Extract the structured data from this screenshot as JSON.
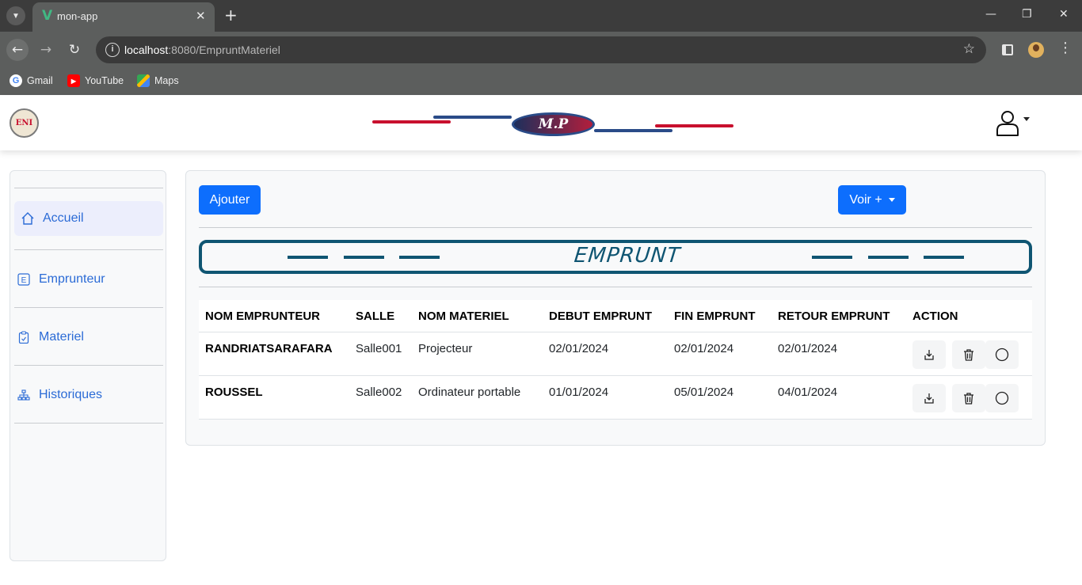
{
  "browser": {
    "tab_title": "mon-app",
    "tab_close": "✕",
    "new_tab": "+",
    "url_host": "localhost",
    "url_path": ":8080/EmpruntMateriel",
    "bookmarks": [
      {
        "label": "Gmail",
        "icon": "google-icon"
      },
      {
        "label": "YouTube",
        "icon": "youtube-icon"
      },
      {
        "label": "Maps",
        "icon": "maps-icon"
      }
    ]
  },
  "header": {
    "logo_text": "ENI",
    "brand": "M.P",
    "colors": {
      "red": "#c8102e",
      "blue": "#2a4b88"
    }
  },
  "sidebar": {
    "items": [
      {
        "label": "Accueil",
        "icon": "home-icon",
        "active": true
      },
      {
        "label": "Emprunteur",
        "icon": "letter-e-icon",
        "active": false
      },
      {
        "label": "Materiel",
        "icon": "clipboard-icon",
        "active": false
      },
      {
        "label": "Historiques",
        "icon": "sitemap-icon",
        "active": false
      }
    ]
  },
  "main": {
    "add_label": "Ajouter",
    "voir_label": "Voir +",
    "banner_title": "EMPRUNT",
    "table": {
      "headers": [
        "NOM EMPRUNTEUR",
        "SALLE",
        "NOM MATERIEL",
        "DEBUT EMPRUNT",
        "FIN EMPRUNT",
        "RETOUR EMPRUNT",
        "ACTION"
      ],
      "rows": [
        [
          "RANDRIATSARAFARA",
          "Salle001",
          "Projecteur",
          "02/01/2024",
          "02/01/2024",
          "02/01/2024"
        ],
        [
          "ROUSSEL",
          "Salle002",
          "Ordinateur portable",
          "01/01/2024",
          "05/01/2024",
          "04/01/2024"
        ]
      ],
      "actions": [
        "download-icon",
        "trash-icon",
        "circle-icon"
      ]
    },
    "colors": {
      "primary": "#0d6efd",
      "banner": "#0f5572",
      "link": "#2b6bd6"
    }
  }
}
